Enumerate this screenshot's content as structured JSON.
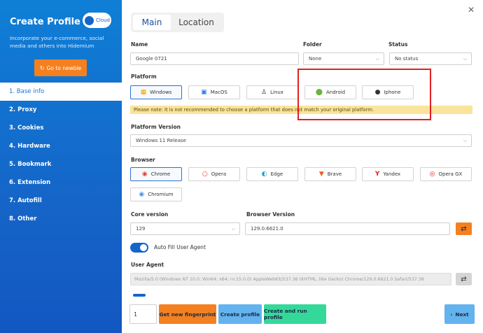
{
  "sidebar": {
    "title": "Create Profile",
    "cloud_label": "Cloud",
    "description": "Incorporate your e-commerce, social media and others into Hidemium",
    "newbie_button": "Go to newbie",
    "menu": [
      "1. Base info",
      "2. Proxy",
      "3. Cookies",
      "4. Hardware",
      "5. Bookmark",
      "6. Extension",
      "7. Autofill",
      "8. Other"
    ],
    "active_index": 0
  },
  "tabs": [
    "Main",
    "Location"
  ],
  "name": {
    "label": "Name",
    "value": "Google 0721"
  },
  "folder": {
    "label": "Folder",
    "value": "None"
  },
  "status": {
    "label": "Status",
    "value": "No status"
  },
  "platform": {
    "label": "Platform",
    "options": [
      "Windows",
      "MacOS",
      "Linux",
      "Android",
      "Iphone"
    ],
    "selected": "Windows",
    "note": "Please note: It is not recommended to choose a platform that does not match your original platform."
  },
  "platform_version": {
    "label": "Platform Version",
    "value": "Windows 11 Release"
  },
  "browser": {
    "label": "Browser",
    "options": [
      "Chrome",
      "Opera",
      "Edge",
      "Brave",
      "Yandex",
      "Opera GX",
      "Chromium"
    ],
    "selected": "Chrome"
  },
  "core_version": {
    "label": "Core version",
    "value": "129"
  },
  "browser_version": {
    "label": "Browser Version",
    "value": "129.0.6621.0"
  },
  "auto_fill": {
    "label": "Auto Fill User Agent",
    "enabled": true
  },
  "user_agent": {
    "label": "User Agent",
    "value": "Mozilla/5.0 (Windows NT 10.0; Win64; x64; rv:15.0.0) AppleWebKit/537.36 (KHTML, like Gecko) Chrome/129.0.6621.0 Safari/537.36"
  },
  "footer": {
    "quantity": "1",
    "get_fingerprint": "Get new fingerprint",
    "create_profile": "Create profile",
    "create_run": "Create and run profile",
    "next": "Next"
  },
  "icons": {
    "close": "close-icon",
    "shuffle": "shuffle-icon",
    "rocket": "rocket-icon",
    "chevron": "chevron-down-icon",
    "next": "chevron-right-icon"
  },
  "colors": {
    "sidebar": "#1565c8",
    "accent": "#f4801f",
    "blue_button": "#63b3ef",
    "green_button": "#34d99a",
    "note_bg": "#fae49b"
  }
}
